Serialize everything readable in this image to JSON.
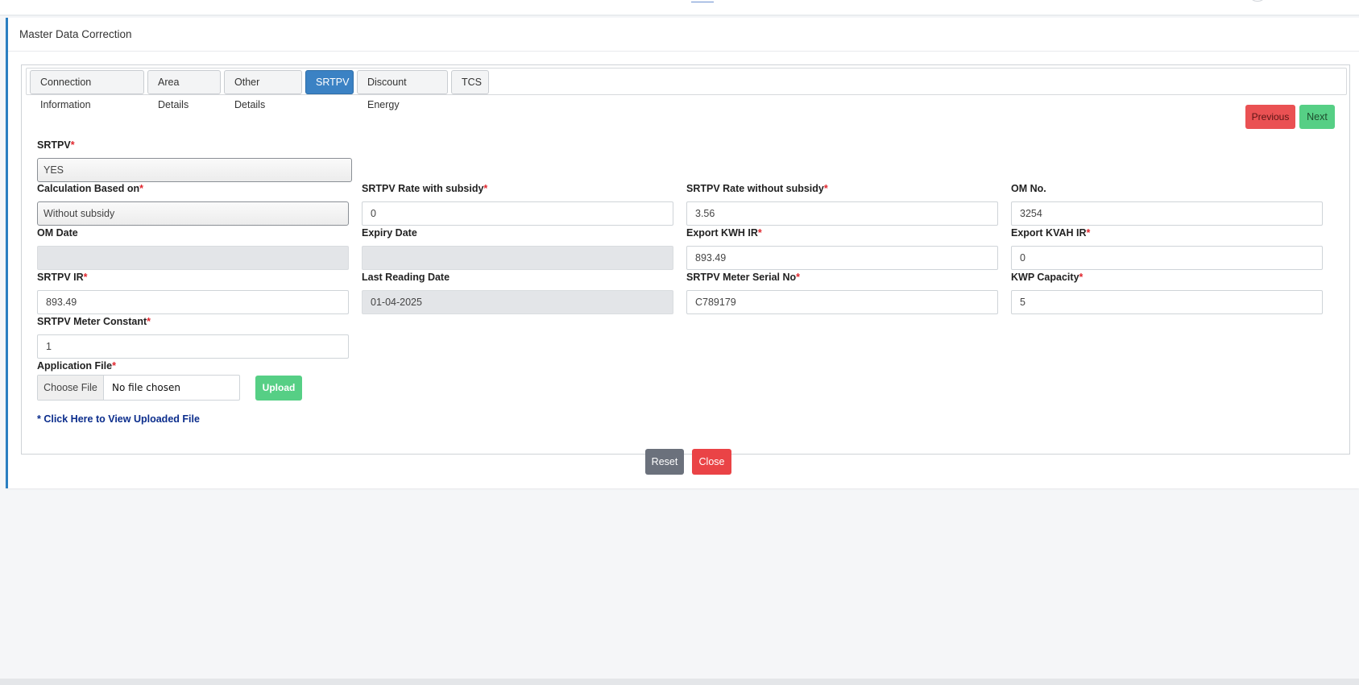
{
  "page": {
    "title": "Master Data Correction"
  },
  "tabs": [
    {
      "label": "Connection Information",
      "active": false
    },
    {
      "label": "Area Details",
      "active": false
    },
    {
      "label": "Other Details",
      "active": false
    },
    {
      "label": "SRTPV",
      "active": true
    },
    {
      "label": "Discount Energy",
      "active": false
    },
    {
      "label": "TCS",
      "active": false
    }
  ],
  "nav": {
    "previous": "Previous",
    "next": "Next"
  },
  "fields": {
    "srtpv": {
      "label": "SRTPV",
      "required": "*",
      "value": "YES"
    },
    "calc_based_on": {
      "label": "Calculation Based on",
      "required": "*",
      "value": "Without subsidy"
    },
    "rate_with_subsidy": {
      "label": "SRTPV Rate with subsidy",
      "required": "*",
      "value": "0"
    },
    "rate_without_subsidy": {
      "label": "SRTPV Rate without subsidy",
      "required": "*",
      "value": "3.56"
    },
    "om_no": {
      "label": "OM No.",
      "value": "3254"
    },
    "om_date": {
      "label": "OM Date",
      "value": ""
    },
    "expiry_date": {
      "label": "Expiry Date",
      "value": ""
    },
    "export_kwh_ir": {
      "label": "Export KWH IR",
      "required": "*",
      "value": "893.49"
    },
    "export_kvah_ir": {
      "label": "Export KVAH IR",
      "required": "*",
      "value": "0"
    },
    "srtpv_ir": {
      "label": "SRTPV IR",
      "required": "*",
      "value": "893.49"
    },
    "last_reading_date": {
      "label": "Last Reading Date",
      "value": "01-04-2025"
    },
    "meter_serial_no": {
      "label": "SRTPV Meter Serial No",
      "required": "*",
      "value": "C789179"
    },
    "kwp_capacity": {
      "label": "KWP Capacity",
      "required": "*",
      "value": "5"
    },
    "meter_constant": {
      "label": "SRTPV Meter Constant",
      "required": "*",
      "value": "1"
    },
    "application_file": {
      "label": "Application File",
      "required": "*",
      "choose": "Choose File",
      "status": "No file chosen"
    }
  },
  "upload_label": "Upload",
  "view_link": "* Click Here to View Uploaded File",
  "footer": {
    "reset": "Reset",
    "close": "Close"
  },
  "colors": {
    "accent": "#3b82c4",
    "danger": "#ea4346",
    "success": "#56cf85",
    "secondary": "#6b717c",
    "link": "#0b2d8c"
  }
}
